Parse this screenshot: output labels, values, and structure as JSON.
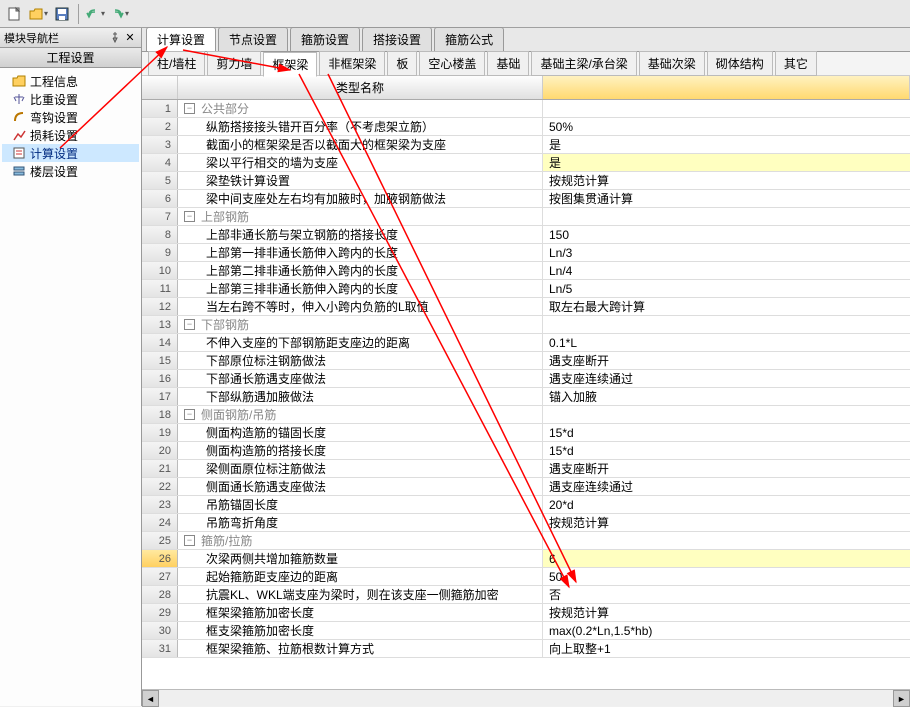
{
  "toolbar": {},
  "sidebar": {
    "header": "模块导航栏",
    "title": "工程设置",
    "items": [
      {
        "icon": "folder",
        "label": "工程信息"
      },
      {
        "icon": "scale",
        "label": "比重设置"
      },
      {
        "icon": "bend",
        "label": "弯钩设置"
      },
      {
        "icon": "loss",
        "label": "损耗设置"
      },
      {
        "icon": "calc",
        "label": "计算设置",
        "selected": true
      },
      {
        "icon": "floor",
        "label": "楼层设置"
      }
    ]
  },
  "tabs": [
    {
      "label": "计算设置",
      "active": true
    },
    {
      "label": "节点设置"
    },
    {
      "label": "箍筋设置"
    },
    {
      "label": "搭接设置"
    },
    {
      "label": "箍筋公式"
    }
  ],
  "subtabs": [
    {
      "label": "柱/墙柱"
    },
    {
      "label": "剪力墙"
    },
    {
      "label": "框架梁",
      "active": true
    },
    {
      "label": "非框架梁"
    },
    {
      "label": "板"
    },
    {
      "label": "空心楼盖"
    },
    {
      "label": "基础"
    },
    {
      "label": "基础主梁/承台梁"
    },
    {
      "label": "基础次梁"
    },
    {
      "label": "砌体结构"
    },
    {
      "label": "其它"
    }
  ],
  "grid": {
    "header": {
      "col1": "",
      "col2": "类型名称",
      "col3": ""
    },
    "rows": [
      {
        "n": "1",
        "group": true,
        "name": "公共部分",
        "val": ""
      },
      {
        "n": "2",
        "name": "纵筋搭接接头错开百分率（不考虑架立筋）",
        "val": "50%"
      },
      {
        "n": "3",
        "name": "截面小的框架梁是否以截面大的框架梁为支座",
        "val": "是"
      },
      {
        "n": "4",
        "name": "梁以平行相交的墙为支座",
        "val": "是",
        "hl": true
      },
      {
        "n": "5",
        "name": "梁垫铁计算设置",
        "val": "按规范计算"
      },
      {
        "n": "6",
        "name": "梁中间支座处左右均有加腋时，加腋钢筋做法",
        "val": "按图集贯通计算"
      },
      {
        "n": "7",
        "group": true,
        "name": "上部钢筋",
        "val": ""
      },
      {
        "n": "8",
        "name": "上部非通长筋与架立钢筋的搭接长度",
        "val": "150"
      },
      {
        "n": "9",
        "name": "上部第一排非通长筋伸入跨内的长度",
        "val": "Ln/3"
      },
      {
        "n": "10",
        "name": "上部第二排非通长筋伸入跨内的长度",
        "val": "Ln/4"
      },
      {
        "n": "11",
        "name": "上部第三排非通长筋伸入跨内的长度",
        "val": "Ln/5"
      },
      {
        "n": "12",
        "name": "当左右跨不等时，伸入小跨内负筋的L取值",
        "val": "取左右最大跨计算"
      },
      {
        "n": "13",
        "group": true,
        "name": "下部钢筋",
        "val": ""
      },
      {
        "n": "14",
        "name": "不伸入支座的下部钢筋距支座边的距离",
        "val": "0.1*L"
      },
      {
        "n": "15",
        "name": "下部原位标注钢筋做法",
        "val": "遇支座断开"
      },
      {
        "n": "16",
        "name": "下部通长筋遇支座做法",
        "val": "遇支座连续通过"
      },
      {
        "n": "17",
        "name": "下部纵筋遇加腋做法",
        "val": "锚入加腋"
      },
      {
        "n": "18",
        "group": true,
        "name": "侧面钢筋/吊筋",
        "val": ""
      },
      {
        "n": "19",
        "name": "侧面构造筋的锚固长度",
        "val": "15*d"
      },
      {
        "n": "20",
        "name": "侧面构造筋的搭接长度",
        "val": "15*d"
      },
      {
        "n": "21",
        "name": "梁侧面原位标注筋做法",
        "val": "遇支座断开"
      },
      {
        "n": "22",
        "name": "侧面通长筋遇支座做法",
        "val": "遇支座连续通过"
      },
      {
        "n": "23",
        "name": "吊筋锚固长度",
        "val": "20*d"
      },
      {
        "n": "24",
        "name": "吊筋弯折角度",
        "val": "按规范计算"
      },
      {
        "n": "25",
        "group": true,
        "name": "箍筋/拉筋",
        "val": ""
      },
      {
        "n": "26",
        "name": "次梁两侧共增加箍筋数量",
        "val": "6",
        "hl": true,
        "selected": true
      },
      {
        "n": "27",
        "name": "起始箍筋距支座边的距离",
        "val": "50"
      },
      {
        "n": "28",
        "name": "抗震KL、WKL端支座为梁时，则在该支座一侧箍筋加密",
        "val": "否"
      },
      {
        "n": "29",
        "name": "框架梁箍筋加密长度",
        "val": "按规范计算"
      },
      {
        "n": "30",
        "name": "框支梁箍筋加密长度",
        "val": "max(0.2*Ln,1.5*hb)"
      },
      {
        "n": "31",
        "name": "框架梁箍筋、拉筋根数计算方式",
        "val": "向上取整+1"
      }
    ]
  }
}
